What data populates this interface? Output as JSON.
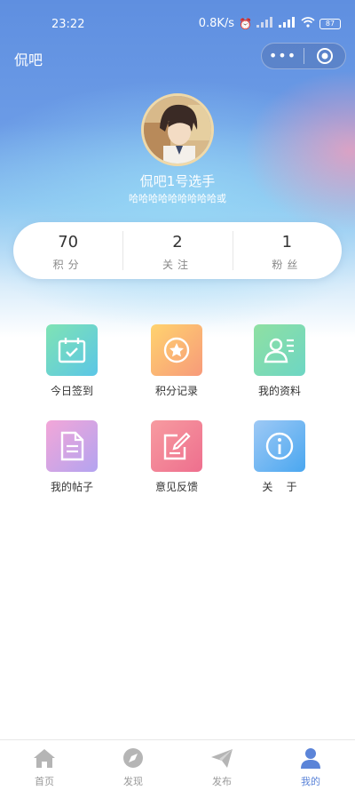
{
  "status": {
    "time": "23:22",
    "speed": "0.8K/s",
    "battery": "87"
  },
  "header": {
    "title": "侃吧",
    "menu_dots": "•••"
  },
  "profile": {
    "nickname": "侃吧1号选手",
    "signature": "哈哈哈哈哈哈哈哈哈或"
  },
  "stats": [
    {
      "value": "70",
      "label": "积分"
    },
    {
      "value": "2",
      "label": "关注"
    },
    {
      "value": "1",
      "label": "粉丝"
    }
  ],
  "menu": [
    {
      "label": "今日签到",
      "icon": "calendar-check-icon"
    },
    {
      "label": "积分记录",
      "icon": "star-badge-icon"
    },
    {
      "label": "我的资料",
      "icon": "user-profile-icon"
    },
    {
      "label": "我的帖子",
      "icon": "document-icon"
    },
    {
      "label": "意见反馈",
      "icon": "edit-note-icon"
    },
    {
      "label": "关    于",
      "icon": "info-icon"
    }
  ],
  "colors": {
    "accent": "#5b84d8",
    "nav_inactive": "#999999"
  },
  "nav": [
    {
      "label": "首页",
      "icon": "home-icon"
    },
    {
      "label": "发现",
      "icon": "compass-icon"
    },
    {
      "label": "发布",
      "icon": "paper-plane-icon"
    },
    {
      "label": "我的",
      "icon": "user-icon"
    }
  ]
}
